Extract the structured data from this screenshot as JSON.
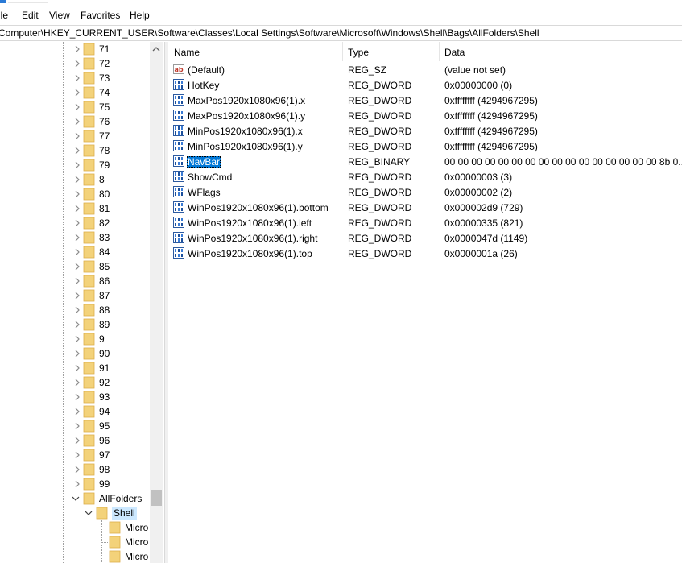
{
  "menu": [
    "ile",
    "Edit",
    "View",
    "Favorites",
    "Help"
  ],
  "address": "Computer\\HKEY_CURRENT_USER\\Software\\Classes\\Local Settings\\Software\\Microsoft\\Windows\\Shell\\Bags\\AllFolders\\Shell",
  "tree": {
    "items": [
      {
        "label": "71",
        "expander": "collapsed"
      },
      {
        "label": "72",
        "expander": "collapsed"
      },
      {
        "label": "73",
        "expander": "collapsed"
      },
      {
        "label": "74",
        "expander": "collapsed"
      },
      {
        "label": "75",
        "expander": "collapsed"
      },
      {
        "label": "76",
        "expander": "collapsed"
      },
      {
        "label": "77",
        "expander": "collapsed"
      },
      {
        "label": "78",
        "expander": "collapsed"
      },
      {
        "label": "79",
        "expander": "collapsed"
      },
      {
        "label": "8",
        "expander": "collapsed"
      },
      {
        "label": "80",
        "expander": "collapsed"
      },
      {
        "label": "81",
        "expander": "collapsed"
      },
      {
        "label": "82",
        "expander": "collapsed"
      },
      {
        "label": "83",
        "expander": "collapsed"
      },
      {
        "label": "84",
        "expander": "collapsed"
      },
      {
        "label": "85",
        "expander": "collapsed"
      },
      {
        "label": "86",
        "expander": "collapsed"
      },
      {
        "label": "87",
        "expander": "collapsed"
      },
      {
        "label": "88",
        "expander": "collapsed"
      },
      {
        "label": "89",
        "expander": "collapsed"
      },
      {
        "label": "9",
        "expander": "collapsed"
      },
      {
        "label": "90",
        "expander": "collapsed"
      },
      {
        "label": "91",
        "expander": "collapsed"
      },
      {
        "label": "92",
        "expander": "collapsed"
      },
      {
        "label": "93",
        "expander": "collapsed"
      },
      {
        "label": "94",
        "expander": "collapsed"
      },
      {
        "label": "95",
        "expander": "collapsed"
      },
      {
        "label": "96",
        "expander": "collapsed"
      },
      {
        "label": "97",
        "expander": "collapsed"
      },
      {
        "label": "98",
        "expander": "collapsed"
      },
      {
        "label": "99",
        "expander": "collapsed"
      },
      {
        "label": "AllFolders",
        "expander": "expanded"
      },
      {
        "label": "Shell",
        "expander": "expanded",
        "selected": true
      },
      {
        "label": "Micro",
        "expander": "none"
      },
      {
        "label": "Micro",
        "expander": "none"
      },
      {
        "label": "Micro",
        "expander": "none"
      }
    ]
  },
  "list": {
    "columns": [
      "Name",
      "Type",
      "Data"
    ],
    "rows": [
      {
        "name": "(Default)",
        "type": "REG_SZ",
        "data": "(value not set)",
        "icon": "string-value-icon"
      },
      {
        "name": "HotKey",
        "type": "REG_DWORD",
        "data": "0x00000000 (0)",
        "icon": "binary-value-icon"
      },
      {
        "name": "MaxPos1920x1080x96(1).x",
        "type": "REG_DWORD",
        "data": "0xffffffff (4294967295)",
        "icon": "binary-value-icon"
      },
      {
        "name": "MaxPos1920x1080x96(1).y",
        "type": "REG_DWORD",
        "data": "0xffffffff (4294967295)",
        "icon": "binary-value-icon"
      },
      {
        "name": "MinPos1920x1080x96(1).x",
        "type": "REG_DWORD",
        "data": "0xffffffff (4294967295)",
        "icon": "binary-value-icon"
      },
      {
        "name": "MinPos1920x1080x96(1).y",
        "type": "REG_DWORD",
        "data": "0xffffffff (4294967295)",
        "icon": "binary-value-icon"
      },
      {
        "name": "NavBar",
        "type": "REG_BINARY",
        "data": "00 00 00 00 00 00 00 00 00 00 00 00 00 00 00 00 8b 0...",
        "icon": "binary-value-icon",
        "selected": true
      },
      {
        "name": "ShowCmd",
        "type": "REG_DWORD",
        "data": "0x00000003 (3)",
        "icon": "binary-value-icon"
      },
      {
        "name": "WFlags",
        "type": "REG_DWORD",
        "data": "0x00000002 (2)",
        "icon": "binary-value-icon"
      },
      {
        "name": "WinPos1920x1080x96(1).bottom",
        "type": "REG_DWORD",
        "data": "0x000002d9 (729)",
        "icon": "binary-value-icon"
      },
      {
        "name": "WinPos1920x1080x96(1).left",
        "type": "REG_DWORD",
        "data": "0x00000335 (821)",
        "icon": "binary-value-icon"
      },
      {
        "name": "WinPos1920x1080x96(1).right",
        "type": "REG_DWORD",
        "data": "0x0000047d (1149)",
        "icon": "binary-value-icon"
      },
      {
        "name": "WinPos1920x1080x96(1).top",
        "type": "REG_DWORD",
        "data": "0x0000001a (26)",
        "icon": "binary-value-icon"
      }
    ]
  },
  "colors": {
    "folder": "#f3d27a",
    "folder_edge": "#dcae4a",
    "selection": "#0078d7",
    "tree_selection": "#cce8ff"
  }
}
